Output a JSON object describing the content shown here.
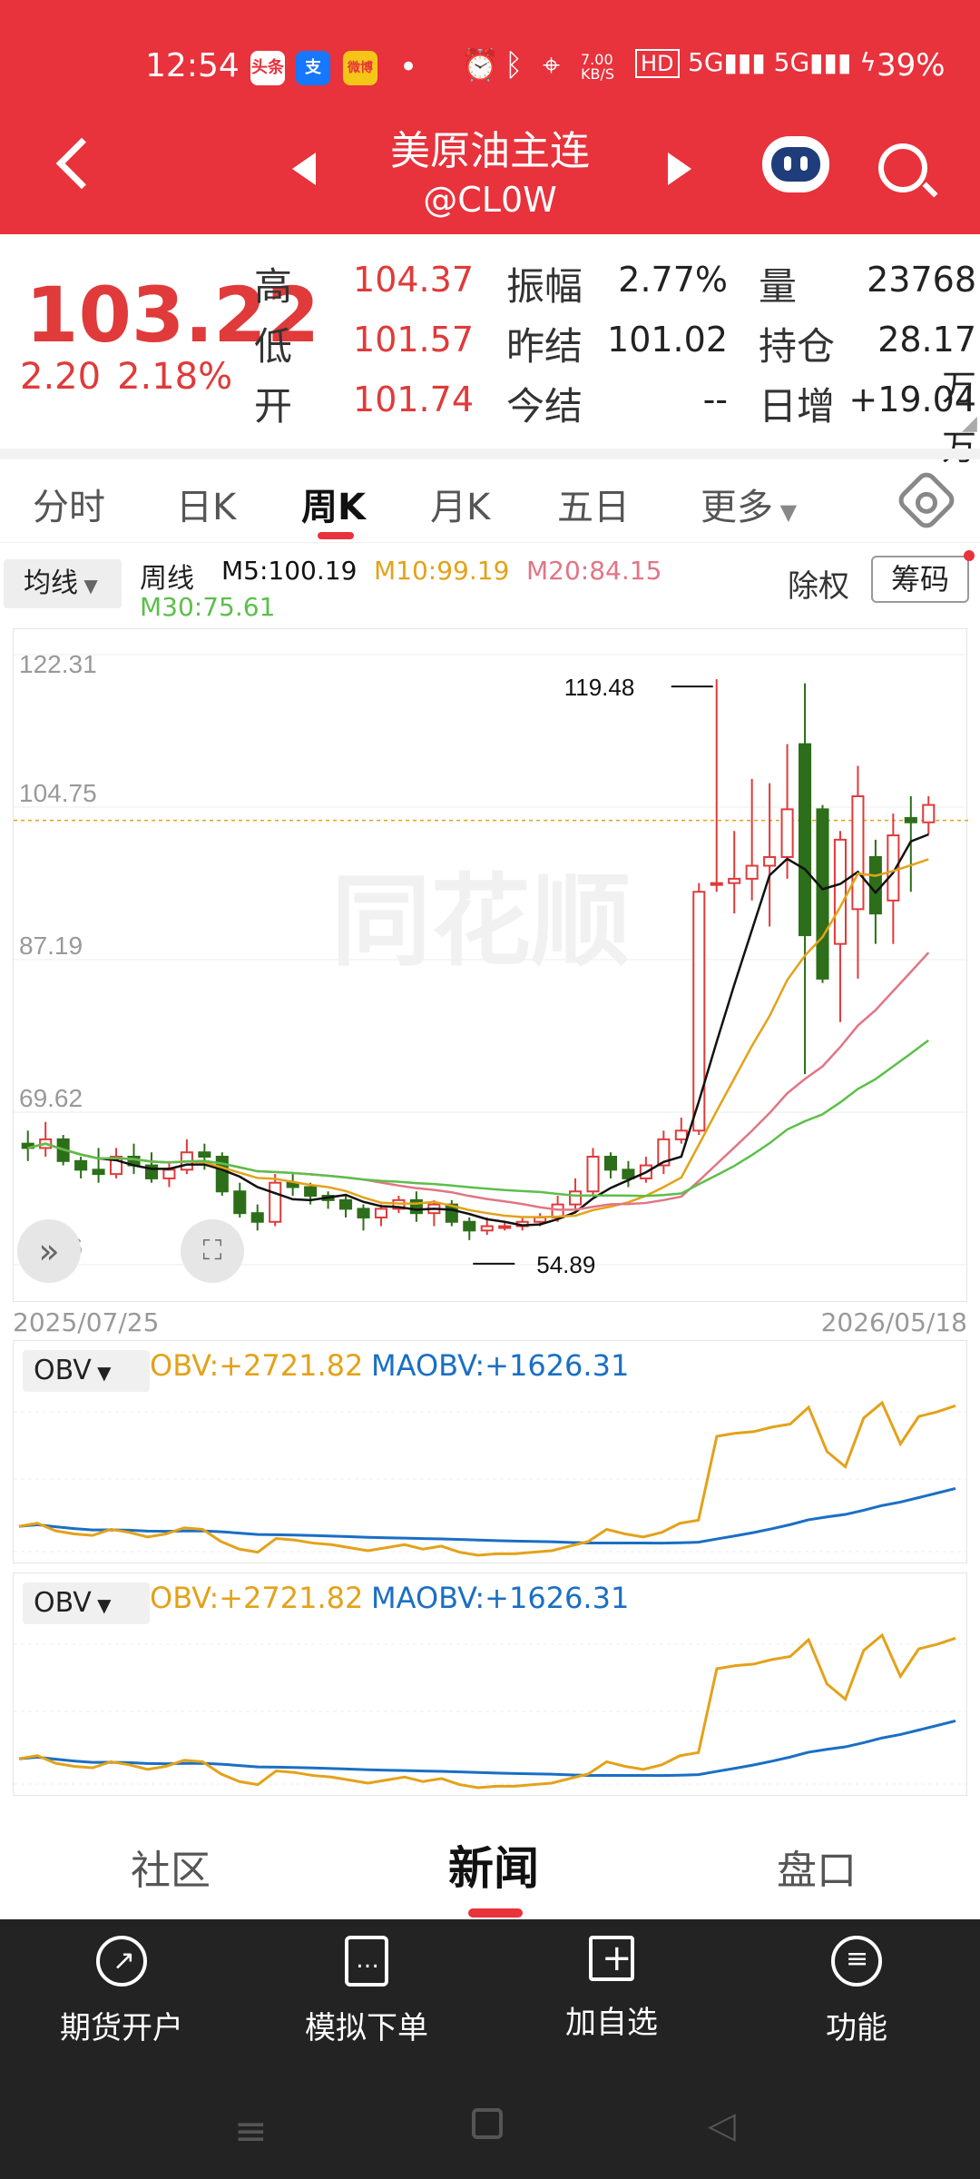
{
  "status": {
    "time": "12:54",
    "apps": [
      "头条",
      "支",
      "微博"
    ],
    "net_speed": "7.00 KB/S",
    "battery": "39%"
  },
  "header": {
    "title": "美原油主连",
    "subtitle": "@CL0W"
  },
  "quote": {
    "price": "103.22",
    "change": "2.20",
    "change_pct": "2.18%",
    "fields": [
      {
        "label": "高",
        "value": "104.37"
      },
      {
        "label": "低",
        "value": "101.57"
      },
      {
        "label": "开",
        "value": "101.74"
      },
      {
        "label": "振幅",
        "value": "2.77%"
      },
      {
        "label": "昨结",
        "value": "101.02"
      },
      {
        "label": "今结",
        "value": "--"
      },
      {
        "label": "量",
        "value": "23768"
      },
      {
        "label": "持仓",
        "value": "28.17万"
      },
      {
        "label": "日增",
        "value": "+19.04万"
      }
    ]
  },
  "tabs": [
    "分时",
    "日K",
    "周K",
    "月K",
    "五日",
    "更多"
  ],
  "active_tab": "周K",
  "legend": {
    "ma_button": "均线",
    "period": "周线",
    "m5": "M5:100.19",
    "m10": "M10:99.19",
    "m20": "M20:84.15",
    "m30": "M30:75.61",
    "chuquan": "除权",
    "chouma": "筹码"
  },
  "colors": {
    "brand": "#e8323c",
    "up": "#e03a3a",
    "down": "#2d6e1a",
    "m5": "#111111",
    "m10": "#e3a21a",
    "m20": "#e27585",
    "m30": "#5cbf4a",
    "obv": "#e3a21a",
    "maobv": "#1a6fc4"
  },
  "chart_data": {
    "type": "candlestick",
    "y_ticks": [
      "122.31",
      "104.75",
      "87.19",
      "69.62",
      "52.06"
    ],
    "ylim": [
      52.06,
      122.31
    ],
    "high_annotation": "119.48",
    "low_annotation": "54.89",
    "date_start": "2025/07/25",
    "date_end": "2026/05/18",
    "watermark": "同花顺",
    "candles": [
      [
        66.0,
        65.5,
        67.5,
        64.0
      ],
      [
        65.5,
        66.5,
        68.5,
        64.5
      ],
      [
        66.5,
        64.0,
        67.0,
        63.5
      ],
      [
        64.0,
        63.0,
        64.5,
        62.0
      ],
      [
        63.0,
        62.5,
        65.5,
        61.5
      ],
      [
        62.5,
        64.5,
        65.5,
        62.0
      ],
      [
        64.5,
        63.5,
        66.0,
        62.5
      ],
      [
        63.5,
        62.0,
        65.0,
        61.5
      ],
      [
        62.0,
        63.0,
        64.0,
        61.0
      ],
      [
        63.0,
        65.0,
        66.5,
        62.5
      ],
      [
        65.0,
        64.5,
        66.0,
        63.0
      ],
      [
        64.5,
        60.5,
        65.0,
        60.0
      ],
      [
        60.5,
        58.0,
        61.5,
        57.5
      ],
      [
        58.0,
        57.0,
        59.0,
        56.0
      ],
      [
        57.0,
        61.5,
        62.5,
        56.5
      ],
      [
        61.5,
        61.0,
        62.5,
        60.0
      ],
      [
        61.0,
        60.0,
        61.5,
        59.0
      ],
      [
        60.0,
        59.5,
        60.5,
        58.5
      ],
      [
        59.5,
        58.5,
        60.0,
        57.5
      ],
      [
        58.5,
        57.5,
        59.0,
        56.0
      ],
      [
        57.5,
        58.5,
        59.0,
        56.5
      ],
      [
        58.5,
        59.5,
        60.0,
        58.0
      ],
      [
        59.5,
        58.0,
        60.5,
        57.0
      ],
      [
        58.0,
        59.0,
        59.5,
        56.5
      ],
      [
        59.0,
        57.0,
        59.5,
        56.5
      ],
      [
        57.0,
        56.0,
        57.5,
        54.9
      ],
      [
        56.0,
        56.5,
        57.5,
        55.5
      ],
      [
        56.5,
        56.5,
        57.0,
        56.0
      ],
      [
        56.5,
        57.0,
        57.5,
        56.0
      ],
      [
        57.0,
        57.5,
        58.0,
        56.5
      ],
      [
        57.5,
        59.0,
        60.0,
        57.0
      ],
      [
        59.0,
        60.5,
        62.0,
        58.5
      ],
      [
        60.5,
        64.5,
        65.5,
        60.0
      ],
      [
        64.5,
        63.0,
        65.0,
        62.0
      ],
      [
        63.0,
        62.0,
        64.0,
        61.0
      ],
      [
        62.0,
        63.5,
        64.5,
        61.5
      ],
      [
        63.5,
        66.5,
        67.5,
        62.5
      ],
      [
        66.5,
        67.5,
        69.0,
        66.0
      ],
      [
        67.5,
        95.0,
        96.0,
        67.0
      ],
      [
        96.0,
        96.0,
        119.48,
        95.0
      ],
      [
        96.0,
        96.5,
        102.0,
        92.5
      ],
      [
        96.5,
        98.0,
        108.0,
        94.0
      ],
      [
        98.0,
        99.0,
        107.5,
        91.0
      ],
      [
        99.0,
        104.5,
        112.0,
        96.5
      ],
      [
        112.0,
        90.0,
        119.0,
        74.0
      ],
      [
        104.5,
        85.0,
        105.0,
        84.5
      ],
      [
        89.0,
        101.0,
        102.0,
        80.0
      ],
      [
        93.0,
        106.0,
        109.5,
        85.0
      ],
      [
        99.0,
        92.5,
        101.0,
        89.0
      ],
      [
        94.0,
        101.5,
        104.0,
        89.0
      ],
      [
        103.5,
        103.0,
        106.0,
        95.0
      ],
      [
        103.0,
        105.0,
        106.0,
        101.57
      ]
    ]
  },
  "obv1": {
    "select": "OBV",
    "obv": "OBV:+2721.82",
    "maobv": "MAOBV:+1626.31"
  },
  "obv2": {
    "select": "OBV",
    "obv": "OBV:+2721.82",
    "maobv": "MAOBV:+1626.31"
  },
  "bottom_tabs": [
    "社区",
    "新闻",
    "盘口"
  ],
  "active_bottom": "新闻",
  "toolbar": [
    "期货开户",
    "模拟下单",
    "加自选",
    "功能"
  ]
}
